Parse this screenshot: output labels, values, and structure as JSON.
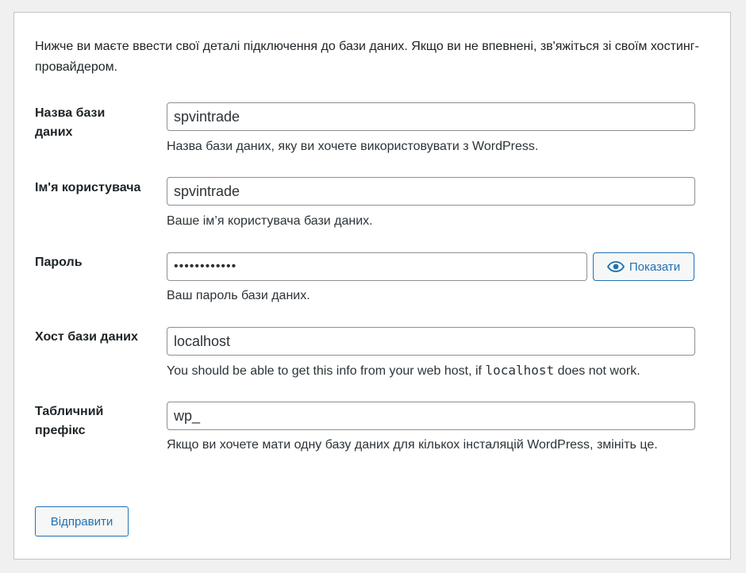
{
  "intro": "Нижче ви маєте ввести свої деталі підключення до бази даних. Якщо ви не впевнені, зв'яжіться зі своїм хостинг-провайдером.",
  "fields": {
    "dbname": {
      "label": "Назва бази даних",
      "value": "spvintrade",
      "description": "Назва бази даних, яку ви хочете використовувати з WordPress."
    },
    "username": {
      "label": "Ім'я користувача",
      "value": "spvintrade",
      "description": "Ваше ім’я користувача бази даних."
    },
    "password": {
      "label": "Пароль",
      "value": "••••••••••••",
      "description": "Ваш пароль бази даних.",
      "show_label": "Показати",
      "show_icon": "eye-icon"
    },
    "host": {
      "label": "Хост бази даних",
      "value": "localhost",
      "description_before": "You should be able to get this info from your web host, if ",
      "description_code": "localhost",
      "description_after": " does not work."
    },
    "prefix": {
      "label": "Табличний префікс",
      "value": "wp_",
      "description": "Якщо ви хочете мати одну базу даних для кількох інсталяцій WordPress, змініть це."
    }
  },
  "submit_label": "Відправити",
  "colors": {
    "accent": "#2271b1",
    "background": "#f0f0f1",
    "panel": "#ffffff",
    "border": "#8c8f94"
  }
}
